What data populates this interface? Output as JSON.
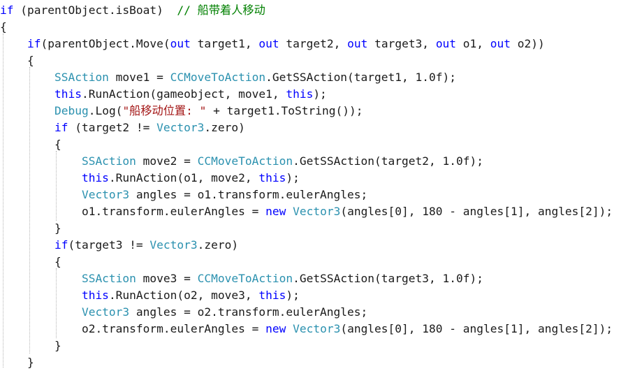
{
  "editor": {
    "theme": {
      "background": "#ffffff",
      "keyword": "#0000ff",
      "type": "#2b91af",
      "comment": "#008000",
      "string": "#a31515",
      "plain": "#1a1a1a"
    },
    "lines": [
      {
        "tokens": [
          {
            "t": "if",
            "c": "kw"
          },
          {
            "t": " (parentObject.isBoat)  ",
            "c": "pl"
          },
          {
            "t": "// 船带着人移动",
            "c": "cm"
          }
        ]
      },
      {
        "tokens": [
          {
            "t": "{",
            "c": "pl"
          }
        ]
      },
      {
        "tokens": [
          {
            "t": "    if",
            "c": "kw"
          },
          {
            "t": "(parentObject.Move(",
            "c": "pl"
          },
          {
            "t": "out",
            "c": "kw"
          },
          {
            "t": " target1, ",
            "c": "pl"
          },
          {
            "t": "out",
            "c": "kw"
          },
          {
            "t": " target2, ",
            "c": "pl"
          },
          {
            "t": "out",
            "c": "kw"
          },
          {
            "t": " target3, ",
            "c": "pl"
          },
          {
            "t": "out",
            "c": "kw"
          },
          {
            "t": " o1, ",
            "c": "pl"
          },
          {
            "t": "out",
            "c": "kw"
          },
          {
            "t": " o2))",
            "c": "pl"
          }
        ]
      },
      {
        "tokens": [
          {
            "t": "    {",
            "c": "pl"
          }
        ]
      },
      {
        "tokens": [
          {
            "t": "        SSAction",
            "c": "type"
          },
          {
            "t": " move1 = ",
            "c": "pl"
          },
          {
            "t": "CCMoveToAction",
            "c": "type"
          },
          {
            "t": ".GetSSAction(target1, 1.0f);",
            "c": "pl"
          }
        ]
      },
      {
        "tokens": [
          {
            "t": "        this",
            "c": "kw"
          },
          {
            "t": ".RunAction(gameobject, move1, ",
            "c": "pl"
          },
          {
            "t": "this",
            "c": "kw"
          },
          {
            "t": ");",
            "c": "pl"
          }
        ]
      },
      {
        "tokens": [
          {
            "t": "        Debug",
            "c": "type"
          },
          {
            "t": ".Log(",
            "c": "pl"
          },
          {
            "t": "\"船移动位置: \"",
            "c": "str"
          },
          {
            "t": " + target1.ToString());",
            "c": "pl"
          }
        ]
      },
      {
        "tokens": [
          {
            "t": "        if",
            "c": "kw"
          },
          {
            "t": " (target2 != ",
            "c": "pl"
          },
          {
            "t": "Vector3",
            "c": "type"
          },
          {
            "t": ".zero)",
            "c": "pl"
          }
        ]
      },
      {
        "tokens": [
          {
            "t": "        {",
            "c": "pl"
          }
        ]
      },
      {
        "tokens": [
          {
            "t": "            SSAction",
            "c": "type"
          },
          {
            "t": " move2 = ",
            "c": "pl"
          },
          {
            "t": "CCMoveToAction",
            "c": "type"
          },
          {
            "t": ".GetSSAction(target2, 1.0f);",
            "c": "pl"
          }
        ]
      },
      {
        "tokens": [
          {
            "t": "            this",
            "c": "kw"
          },
          {
            "t": ".RunAction(o1, move2, ",
            "c": "pl"
          },
          {
            "t": "this",
            "c": "kw"
          },
          {
            "t": ");",
            "c": "pl"
          }
        ]
      },
      {
        "tokens": [
          {
            "t": "            Vector3",
            "c": "type"
          },
          {
            "t": " angles = o1.transform.eulerAngles;",
            "c": "pl"
          }
        ]
      },
      {
        "tokens": [
          {
            "t": "            o1.transform.eulerAngles = ",
            "c": "pl"
          },
          {
            "t": "new",
            "c": "kw"
          },
          {
            "t": " ",
            "c": "pl"
          },
          {
            "t": "Vector3",
            "c": "type"
          },
          {
            "t": "(angles[0], 180 - angles[1], angles[2]);",
            "c": "pl"
          }
        ]
      },
      {
        "tokens": [
          {
            "t": "        }",
            "c": "pl"
          }
        ]
      },
      {
        "tokens": [
          {
            "t": "        if",
            "c": "kw"
          },
          {
            "t": "(target3 != ",
            "c": "pl"
          },
          {
            "t": "Vector3",
            "c": "type"
          },
          {
            "t": ".zero)",
            "c": "pl"
          }
        ]
      },
      {
        "tokens": [
          {
            "t": "        {",
            "c": "pl"
          }
        ]
      },
      {
        "tokens": [
          {
            "t": "            SSAction",
            "c": "type"
          },
          {
            "t": " move3 = ",
            "c": "pl"
          },
          {
            "t": "CCMoveToAction",
            "c": "type"
          },
          {
            "t": ".GetSSAction(target3, 1.0f);",
            "c": "pl"
          }
        ]
      },
      {
        "tokens": [
          {
            "t": "            this",
            "c": "kw"
          },
          {
            "t": ".RunAction(o2, move3, ",
            "c": "pl"
          },
          {
            "t": "this",
            "c": "kw"
          },
          {
            "t": ");",
            "c": "pl"
          }
        ]
      },
      {
        "tokens": [
          {
            "t": "            Vector3",
            "c": "type"
          },
          {
            "t": " angles = o2.transform.eulerAngles;",
            "c": "pl"
          }
        ]
      },
      {
        "tokens": [
          {
            "t": "            o2.transform.eulerAngles = ",
            "c": "pl"
          },
          {
            "t": "new",
            "c": "kw"
          },
          {
            "t": " ",
            "c": "pl"
          },
          {
            "t": "Vector3",
            "c": "type"
          },
          {
            "t": "(angles[0], 180 - angles[1], angles[2]);",
            "c": "pl"
          }
        ]
      },
      {
        "tokens": [
          {
            "t": "        }",
            "c": "pl"
          }
        ]
      },
      {
        "tokens": [
          {
            "t": "    }",
            "c": "pl"
          }
        ]
      }
    ]
  }
}
